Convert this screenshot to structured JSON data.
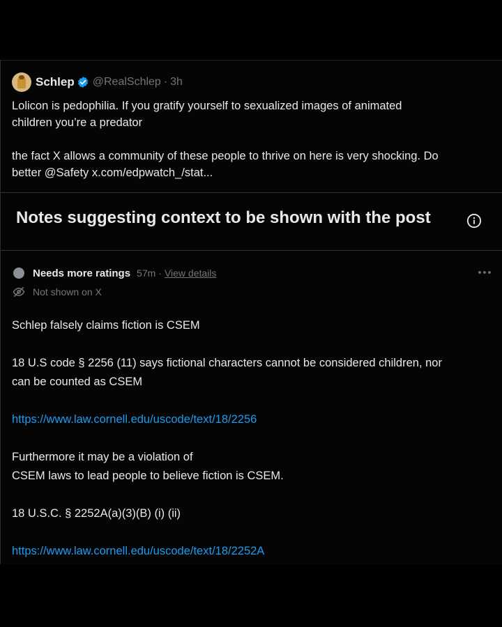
{
  "post": {
    "author_name": "Schlep",
    "handle": "@RealSchlep",
    "separator": "·",
    "time": "3h",
    "line1": "Lolicon is pedophilia. If you gratify yourself to sexualized images of animated",
    "line2": "children you’re a predator",
    "line3": "the fact X allows a community of these people to thrive on here is very shocking. Do",
    "line4": "better @Safety x.com/edpwatch_/stat..."
  },
  "notes_section": {
    "title": "Notes suggesting context to be shown with the post"
  },
  "note": {
    "status": "Needs more ratings",
    "time": "57m",
    "separator": "·",
    "view_details": "View details",
    "visibility": "Not shown on X",
    "body": {
      "p1": "Schlep falsely claims fiction is CSEM",
      "p2_line1": "18 U.S code § 2256 (11) says fictional characters cannot be considered children, nor",
      "p2_line2": "can be counted as CSEM",
      "link1": "https://www.law.cornell.edu/uscode/text/18/2256",
      "p3_line1": "Furthermore it may be a violation of",
      "p3_line2": "CSEM laws to lead people to believe fiction is CSEM.",
      "p4": "18 U.S.C. § 2252A(a)(3)(B) (i) (ii)",
      "link2": "https://www.law.cornell.edu/uscode/text/18/2252A"
    }
  },
  "colors": {
    "background": "#000000",
    "text": "#e7e9ea",
    "muted": "#71767b",
    "link": "#1d9bf0",
    "verified": "#1d9bf0",
    "status_dot": "#8b9096"
  },
  "icons": [
    "avatar",
    "verified-badge-icon",
    "info-icon",
    "more-icon",
    "eye-off-icon"
  ]
}
